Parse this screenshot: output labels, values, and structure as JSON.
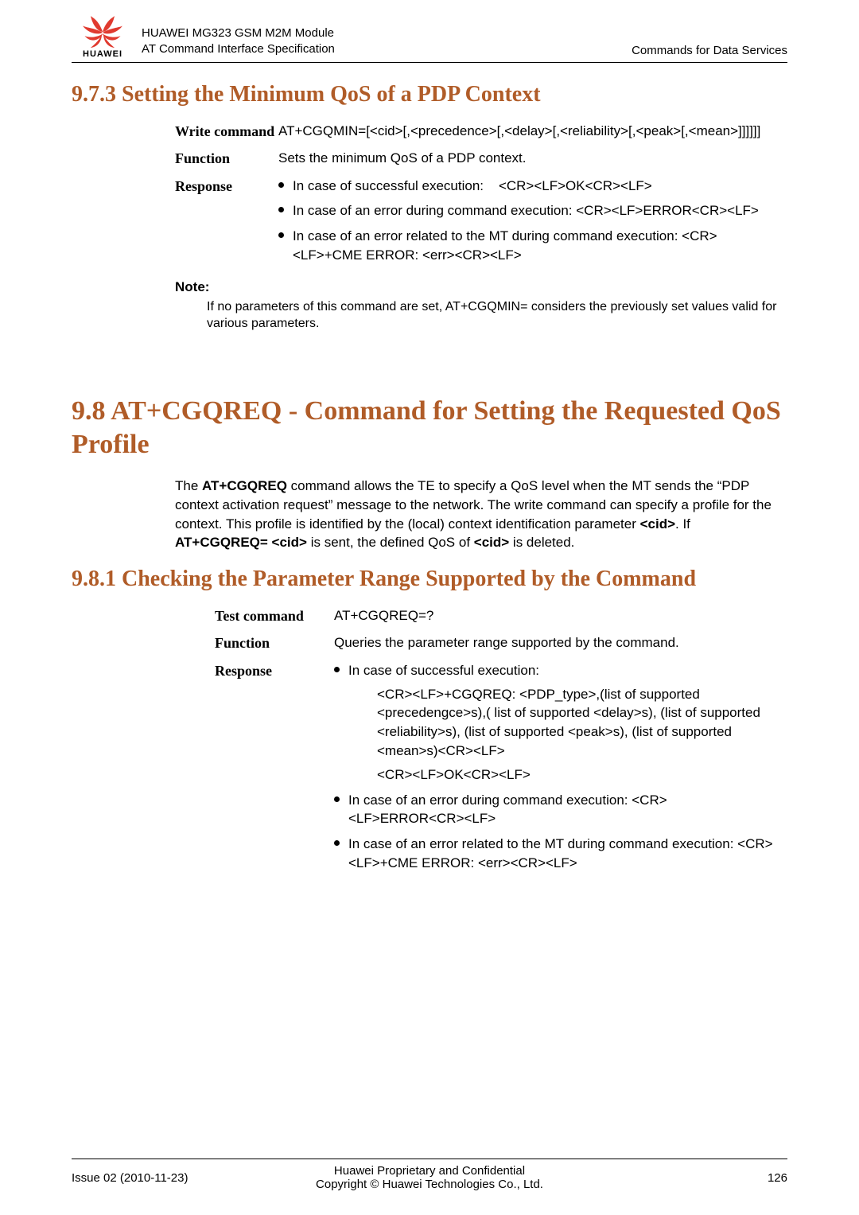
{
  "header": {
    "brand": "HUAWEI",
    "line1": "HUAWEI MG323 GSM M2M Module",
    "line2": "AT Command Interface Specification",
    "right": "Commands for Data Services"
  },
  "section973": {
    "heading": "9.7.3 Setting the Minimum QoS of a PDP Context",
    "write_label": "Write command",
    "write_body": "AT+CGQMIN=[<cid>[,<precedence>[,<delay>[,<reliability>[,<peak>[,<mean>]]]]]]",
    "function_label": "Function",
    "function_body": "Sets the minimum QoS of a PDP context.",
    "response_label": "Response",
    "resp_b1_a": "In case of successful execution:",
    "resp_b1_b": "<CR><LF>OK<CR><LF>",
    "resp_b2_a": "In case of an error during command execution: <CR><LF>ERROR<CR><LF>",
    "resp_b3_a": "In case of an error related to the MT during command execution: <CR><LF>+CME ERROR: <err><CR><LF>",
    "note_title": "Note:",
    "note_body": "If no parameters of this command are set, AT+CGQMIN= considers the previously set values valid for various parameters."
  },
  "section98": {
    "heading": "9.8 AT+CGQREQ - Command for Setting the Requested QoS Profile",
    "para_parts": {
      "p1": "The ",
      "b1": "AT+CGQREQ",
      "p2": " command allows the TE to specify a QoS level when the MT sends the “PDP context activation request” message to the network. The write command can specify a profile for the context. This profile is identified by the (local) context identification parameter ",
      "b2": "<cid>",
      "p3": ". If ",
      "b3": "AT+CGQREQ= <cid>",
      "p4": " is sent, the defined QoS of ",
      "b4": "<cid>",
      "p5": " is deleted."
    }
  },
  "section981": {
    "heading": "9.8.1 Checking the Parameter Range Supported by the Command",
    "test_label": "Test command",
    "test_body": "AT+CGQREQ=?",
    "function_label": "Function",
    "function_body": "Queries the parameter range supported by the command.",
    "response_label": "Response",
    "resp_b1_a": "In case of successful execution:",
    "resp_b1_sub1": "<CR><LF>+CGQREQ: <PDP_type>,(list of supported <precedengce>s),( list of supported <delay>s), (list of supported <reliability>s), (list of supported <peak>s), (list of supported <mean>s)<CR><LF>",
    "resp_b1_sub2": "<CR><LF>OK<CR><LF>",
    "resp_b2": "In case of an error during command execution: <CR><LF>ERROR<CR><LF>",
    "resp_b3": "In case of an error related to the MT during command execution: <CR><LF>+CME ERROR: <err><CR><LF>"
  },
  "footer": {
    "left": "Issue 02 (2010-11-23)",
    "center1": "Huawei Proprietary and Confidential",
    "center2": "Copyright © Huawei Technologies Co., Ltd.",
    "right": "126"
  }
}
